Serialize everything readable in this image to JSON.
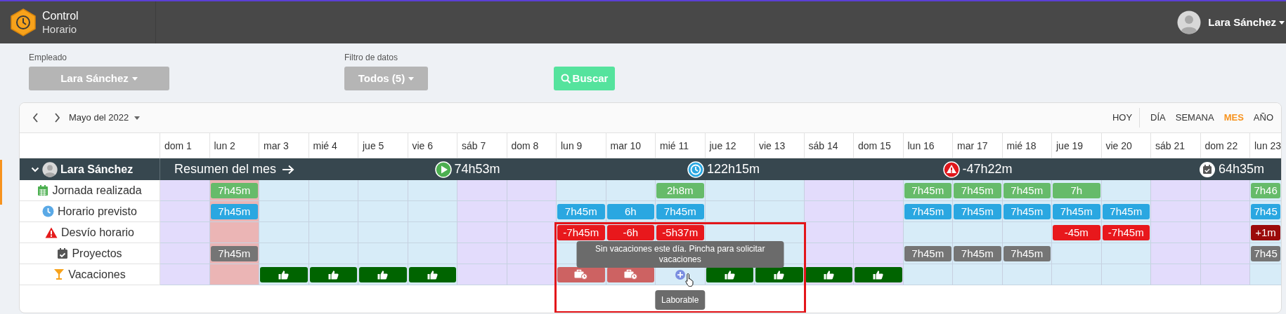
{
  "app": {
    "title": "Control",
    "subtitle": "Horario"
  },
  "user_menu": {
    "name": "Lara Sánchez"
  },
  "filters": [
    {
      "label": "Empleado",
      "value": "Lara Sánchez"
    },
    {
      "label": "Filtro de datos",
      "value": "Todos (5)"
    }
  ],
  "search_button": {
    "label": "Buscar"
  },
  "calendar": {
    "period": "Mayo del 2022",
    "today_button": "HOY",
    "views": [
      {
        "label": "DÍA",
        "selected": false
      },
      {
        "label": "SEMANA",
        "selected": false
      },
      {
        "label": "MES",
        "selected": true
      },
      {
        "label": "AÑO",
        "selected": false
      }
    ],
    "days": [
      {
        "label": "dom 1",
        "kind": "weekend"
      },
      {
        "label": "lun 2",
        "kind": "holiday"
      },
      {
        "label": "mar 3",
        "kind": "weekday"
      },
      {
        "label": "mié 4",
        "kind": "weekday"
      },
      {
        "label": "jue 5",
        "kind": "weekday"
      },
      {
        "label": "vie 6",
        "kind": "weekday"
      },
      {
        "label": "sáb 7",
        "kind": "weekend"
      },
      {
        "label": "dom 8",
        "kind": "weekend"
      },
      {
        "label": "lun 9",
        "kind": "weekday"
      },
      {
        "label": "mar 10",
        "kind": "weekday"
      },
      {
        "label": "mié 11",
        "kind": "weekday"
      },
      {
        "label": "jue 12",
        "kind": "weekday"
      },
      {
        "label": "vie 13",
        "kind": "weekday"
      },
      {
        "label": "sáb 14",
        "kind": "weekend"
      },
      {
        "label": "dom 15",
        "kind": "weekend"
      },
      {
        "label": "lun 16",
        "kind": "weekday"
      },
      {
        "label": "mar 17",
        "kind": "weekday"
      },
      {
        "label": "mié 18",
        "kind": "weekday"
      },
      {
        "label": "jue 19",
        "kind": "weekday"
      },
      {
        "label": "vie 20",
        "kind": "weekday"
      },
      {
        "label": "sáb 21",
        "kind": "weekend"
      },
      {
        "label": "dom 22",
        "kind": "weekend"
      },
      {
        "label": "lun 23",
        "kind": "weekday"
      }
    ],
    "employee": {
      "name": "Lara Sánchez",
      "expanded": true
    },
    "summary": {
      "label": "Resumen del mes",
      "items": [
        {
          "kind": "worked",
          "value": "74h53m"
        },
        {
          "kind": "planned",
          "value": "122h15m"
        },
        {
          "kind": "deviation",
          "value": "-47h22m"
        },
        {
          "kind": "projects",
          "value": "64h35m"
        }
      ]
    },
    "rows": [
      {
        "kind": "worked",
        "label": "Jornada realizada",
        "cells": [
          null,
          {
            "kind": "worked",
            "text": "7h45m"
          },
          null,
          null,
          null,
          null,
          null,
          null,
          null,
          null,
          {
            "kind": "worked",
            "text": "2h8m"
          },
          null,
          null,
          null,
          null,
          {
            "kind": "worked",
            "text": "7h45m"
          },
          {
            "kind": "worked",
            "text": "7h45m"
          },
          {
            "kind": "worked",
            "text": "7h45m"
          },
          {
            "kind": "worked",
            "text": "7h"
          },
          null,
          null,
          null,
          {
            "kind": "worked",
            "text": "7h46"
          }
        ]
      },
      {
        "kind": "planned",
        "label": "Horario previsto",
        "cells": [
          null,
          {
            "kind": "planned",
            "text": "7h45m"
          },
          null,
          null,
          null,
          null,
          null,
          null,
          {
            "kind": "planned",
            "text": "7h45m"
          },
          {
            "kind": "planned",
            "text": "6h"
          },
          {
            "kind": "planned",
            "text": "7h45m"
          },
          null,
          null,
          null,
          null,
          {
            "kind": "planned",
            "text": "7h45m"
          },
          {
            "kind": "planned",
            "text": "7h45m"
          },
          {
            "kind": "planned",
            "text": "7h45m"
          },
          {
            "kind": "planned",
            "text": "7h45m"
          },
          {
            "kind": "planned",
            "text": "7h45m"
          },
          null,
          null,
          {
            "kind": "planned",
            "text": "7h45"
          }
        ]
      },
      {
        "kind": "deviation",
        "label": "Desvío horario",
        "cells": [
          null,
          null,
          null,
          null,
          null,
          null,
          null,
          null,
          {
            "kind": "deficit",
            "text": "-7h45m"
          },
          {
            "kind": "deficit",
            "text": "-6h"
          },
          {
            "kind": "deficit",
            "text": "-5h37m"
          },
          null,
          null,
          null,
          null,
          null,
          null,
          null,
          {
            "kind": "deficit",
            "text": "-45m"
          },
          {
            "kind": "deficit",
            "text": "-7h45m"
          },
          null,
          null,
          {
            "kind": "surplus",
            "text": "+1m"
          }
        ]
      },
      {
        "kind": "projects",
        "label": "Proyectos",
        "cells": [
          null,
          {
            "kind": "project",
            "text": "7h45m"
          },
          null,
          null,
          null,
          null,
          null,
          null,
          null,
          null,
          null,
          null,
          null,
          null,
          null,
          {
            "kind": "project",
            "text": "7h45m"
          },
          {
            "kind": "project",
            "text": "7h45m"
          },
          {
            "kind": "project",
            "text": "7h45m"
          },
          null,
          null,
          null,
          null,
          {
            "kind": "project",
            "text": "7h45"
          }
        ]
      },
      {
        "kind": "vacation",
        "label": "Vacaciones",
        "cells": [
          null,
          null,
          {
            "kind": "approved"
          },
          {
            "kind": "approved"
          },
          {
            "kind": "approved"
          },
          {
            "kind": "approved"
          },
          null,
          null,
          {
            "kind": "pending"
          },
          {
            "kind": "pending"
          },
          {
            "kind": "request",
            "highlighted": true,
            "tooltip": "Sin vacaciones este día. Pincha para solicitar vacaciones",
            "day_type": "Laborable"
          },
          {
            "kind": "approved"
          },
          {
            "kind": "approved"
          },
          {
            "kind": "approved"
          },
          {
            "kind": "approved"
          },
          null,
          null,
          null,
          null,
          null,
          null,
          null,
          null
        ]
      }
    ]
  }
}
